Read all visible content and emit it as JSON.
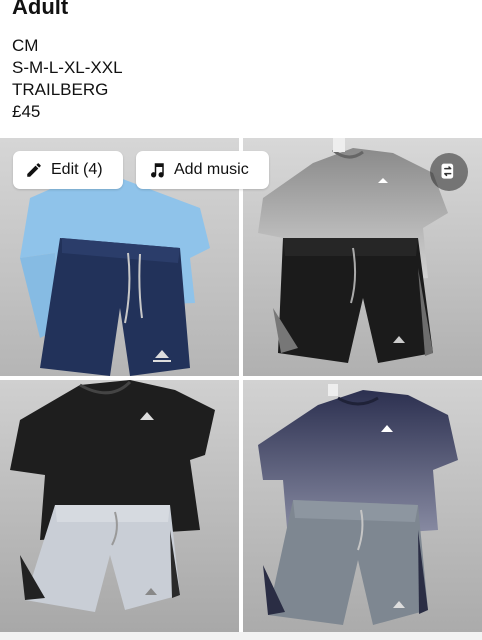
{
  "header": {
    "title": "Adult",
    "lines": [
      "CM",
      "S-M-L-XL-XXL",
      "TRAILBERG",
      "£45"
    ]
  },
  "overlay": {
    "edit_label": "Edit (4)",
    "add_music_label": "Add music"
  },
  "photos": [
    {
      "top_color": "#8fc3ea",
      "shorts_color": "#22325a"
    },
    {
      "top_color": "#8a8a8a",
      "shorts_color": "#1b1b1b"
    },
    {
      "top_color": "#1e1e1e",
      "shorts_color": "#c9ced6"
    },
    {
      "top_color": "#2c3050",
      "shorts_color": "#7e8791"
    }
  ],
  "colors": {
    "background_wall": "#bcbcbc",
    "floor": "#9a9a9a"
  }
}
